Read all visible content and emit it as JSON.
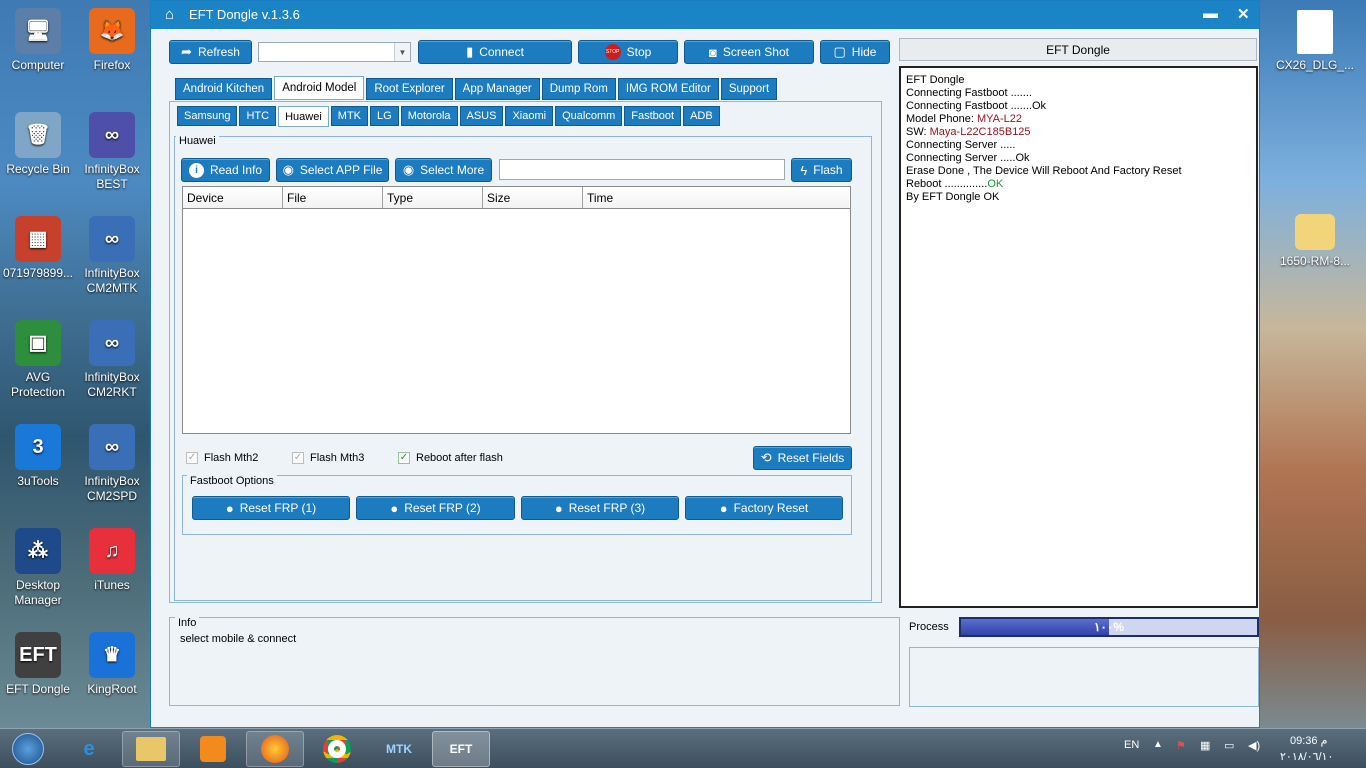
{
  "desktop": {
    "icons": [
      {
        "label": "Computer",
        "glyph": "🖥"
      },
      {
        "label": "Firefox",
        "glyph": "🦊"
      },
      {
        "label": "Recycle Bin",
        "glyph": "🗑"
      },
      {
        "label": "InfinityBox BEST",
        "glyph": "∞"
      },
      {
        "label": "071979899...",
        "glyph": "▦"
      },
      {
        "label": "InfinityBox CM2MTK",
        "glyph": "∞"
      },
      {
        "label": "AVG Protection",
        "glyph": "▣"
      },
      {
        "label": "InfinityBox CM2RKT",
        "glyph": "∞"
      },
      {
        "label": "3uTools",
        "glyph": "3"
      },
      {
        "label": "InfinityBox CM2SPD",
        "glyph": "∞"
      },
      {
        "label": "Desktop Manager",
        "glyph": "⁂"
      },
      {
        "label": "iTunes",
        "glyph": "♫"
      },
      {
        "label": "EFT Dongle",
        "glyph": "EFT"
      },
      {
        "label": "KingRoot",
        "glyph": "♛"
      }
    ],
    "right_icons": [
      {
        "label": "CX26_DLG_..."
      },
      {
        "label": "1650-RM-8..."
      }
    ]
  },
  "window": {
    "title": "EFT Dongle  v.1.3.6",
    "home_glyph": "⌂",
    "minimize_glyph": "▬",
    "close_glyph": "✕"
  },
  "toolbar": {
    "refresh": "Refresh",
    "connect": "Connect",
    "stop": "Stop",
    "screenshot": "Screen Shot",
    "hide": "Hide",
    "port_value": ""
  },
  "tabs": [
    "Android Kitchen",
    "Android Model",
    "Root Explorer",
    "App Manager",
    "Dump Rom",
    "IMG ROM Editor",
    "Support"
  ],
  "active_tab": "Android Model",
  "subtabs": [
    "Samsung",
    "HTC",
    "Huawei",
    "MTK",
    "LG",
    "Motorola",
    "ASUS",
    "Xiaomi",
    "Qualcomm",
    "Fastboot",
    "ADB"
  ],
  "active_subtab": "Huawei",
  "huawei": {
    "group_title": "Huawei",
    "read_info": "Read Info",
    "select_app_file": "Select APP File",
    "select_more": "Select More",
    "file_path": "",
    "flash": "Flash",
    "columns": [
      "Device",
      "File",
      "Type",
      "Size",
      "Time"
    ],
    "flash_mth2": "Flash Mth2",
    "flash_mth3": "Flash Mth3",
    "reboot_after_flash": "Reboot after flash",
    "reset_fields": "Reset Fields",
    "fastboot_title": "Fastboot Options",
    "reset_frp_1": "Reset FRP  (1)",
    "reset_frp_2": "Reset FRP   (2)",
    "reset_frp_3": "Reset FRP  (3)",
    "factory_reset": "Factory Reset"
  },
  "info": {
    "title": "Info",
    "text": "select mobile & connect"
  },
  "log": {
    "header": "EFT Dongle",
    "lines": [
      {
        "text": "EFT Dongle",
        "value": "",
        "value_color": ""
      },
      {
        "text": "Connecting Fastboot .......",
        "value": "",
        "value_color": ""
      },
      {
        "text": "Connecting Fastboot .......Ok",
        "value": "",
        "value_color": ""
      },
      {
        "text": "Model Phone: ",
        "value": "MYA-L22",
        "value_color": "red"
      },
      {
        "text": "SW: ",
        "value": "Maya-L22C185B125",
        "value_color": "red"
      },
      {
        "text": "Connecting Server .....",
        "value": "",
        "value_color": ""
      },
      {
        "text": "Connecting Server .....Ok",
        "value": "",
        "value_color": ""
      },
      {
        "text": "Erase Done , The Device Will Reboot And Factory Reset",
        "value": "",
        "value_color": ""
      },
      {
        "text": "Reboot ..............",
        "value": "OK",
        "value_color": "green"
      },
      {
        "text": "By EFT Dongle OK",
        "value": "",
        "value_color": ""
      }
    ]
  },
  "process": {
    "label": "Process",
    "percent_text": "١٠٠%",
    "fraction": 0.5
  },
  "taskbar": {
    "language": "EN",
    "time": "09:36 م",
    "date": "٢٠١٨/٠٦/١٠"
  },
  "colors": {
    "accent": "#1c7cbf",
    "title_bar": "#1b84c6",
    "log_red": "#a0101a",
    "log_green": "#1a9a2a"
  }
}
